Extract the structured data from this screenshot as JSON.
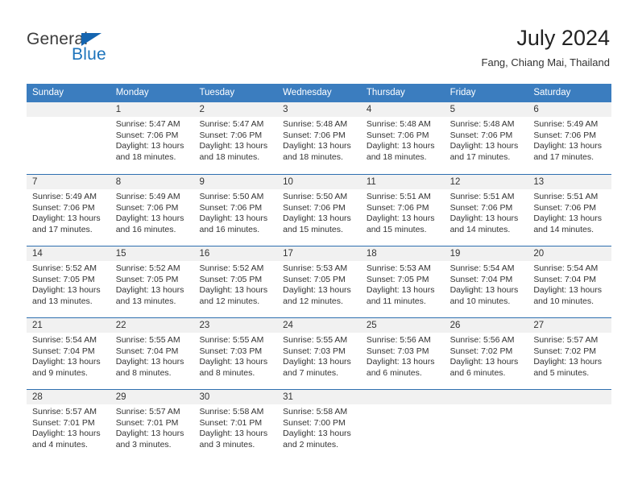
{
  "brand": {
    "name_part1": "General",
    "name_part2": "Blue",
    "accent_color": "#1c73bb"
  },
  "header": {
    "title": "July 2024",
    "subtitle": "Fang, Chiang Mai, Thailand"
  },
  "theme": {
    "header_band": "#3b7dbf",
    "day_band": "#f1f1f1",
    "separator": "#2f6fb0"
  },
  "weekdays": [
    "Sunday",
    "Monday",
    "Tuesday",
    "Wednesday",
    "Thursday",
    "Friday",
    "Saturday"
  ],
  "weeks": [
    [
      {
        "day": "",
        "sunrise": "",
        "sunset": "",
        "daylight": ""
      },
      {
        "day": "1",
        "sunrise": "Sunrise: 5:47 AM",
        "sunset": "Sunset: 7:06 PM",
        "daylight": "Daylight: 13 hours and 18 minutes."
      },
      {
        "day": "2",
        "sunrise": "Sunrise: 5:47 AM",
        "sunset": "Sunset: 7:06 PM",
        "daylight": "Daylight: 13 hours and 18 minutes."
      },
      {
        "day": "3",
        "sunrise": "Sunrise: 5:48 AM",
        "sunset": "Sunset: 7:06 PM",
        "daylight": "Daylight: 13 hours and 18 minutes."
      },
      {
        "day": "4",
        "sunrise": "Sunrise: 5:48 AM",
        "sunset": "Sunset: 7:06 PM",
        "daylight": "Daylight: 13 hours and 18 minutes."
      },
      {
        "day": "5",
        "sunrise": "Sunrise: 5:48 AM",
        "sunset": "Sunset: 7:06 PM",
        "daylight": "Daylight: 13 hours and 17 minutes."
      },
      {
        "day": "6",
        "sunrise": "Sunrise: 5:49 AM",
        "sunset": "Sunset: 7:06 PM",
        "daylight": "Daylight: 13 hours and 17 minutes."
      }
    ],
    [
      {
        "day": "7",
        "sunrise": "Sunrise: 5:49 AM",
        "sunset": "Sunset: 7:06 PM",
        "daylight": "Daylight: 13 hours and 17 minutes."
      },
      {
        "day": "8",
        "sunrise": "Sunrise: 5:49 AM",
        "sunset": "Sunset: 7:06 PM",
        "daylight": "Daylight: 13 hours and 16 minutes."
      },
      {
        "day": "9",
        "sunrise": "Sunrise: 5:50 AM",
        "sunset": "Sunset: 7:06 PM",
        "daylight": "Daylight: 13 hours and 16 minutes."
      },
      {
        "day": "10",
        "sunrise": "Sunrise: 5:50 AM",
        "sunset": "Sunset: 7:06 PM",
        "daylight": "Daylight: 13 hours and 15 minutes."
      },
      {
        "day": "11",
        "sunrise": "Sunrise: 5:51 AM",
        "sunset": "Sunset: 7:06 PM",
        "daylight": "Daylight: 13 hours and 15 minutes."
      },
      {
        "day": "12",
        "sunrise": "Sunrise: 5:51 AM",
        "sunset": "Sunset: 7:06 PM",
        "daylight": "Daylight: 13 hours and 14 minutes."
      },
      {
        "day": "13",
        "sunrise": "Sunrise: 5:51 AM",
        "sunset": "Sunset: 7:06 PM",
        "daylight": "Daylight: 13 hours and 14 minutes."
      }
    ],
    [
      {
        "day": "14",
        "sunrise": "Sunrise: 5:52 AM",
        "sunset": "Sunset: 7:05 PM",
        "daylight": "Daylight: 13 hours and 13 minutes."
      },
      {
        "day": "15",
        "sunrise": "Sunrise: 5:52 AM",
        "sunset": "Sunset: 7:05 PM",
        "daylight": "Daylight: 13 hours and 13 minutes."
      },
      {
        "day": "16",
        "sunrise": "Sunrise: 5:52 AM",
        "sunset": "Sunset: 7:05 PM",
        "daylight": "Daylight: 13 hours and 12 minutes."
      },
      {
        "day": "17",
        "sunrise": "Sunrise: 5:53 AM",
        "sunset": "Sunset: 7:05 PM",
        "daylight": "Daylight: 13 hours and 12 minutes."
      },
      {
        "day": "18",
        "sunrise": "Sunrise: 5:53 AM",
        "sunset": "Sunset: 7:05 PM",
        "daylight": "Daylight: 13 hours and 11 minutes."
      },
      {
        "day": "19",
        "sunrise": "Sunrise: 5:54 AM",
        "sunset": "Sunset: 7:04 PM",
        "daylight": "Daylight: 13 hours and 10 minutes."
      },
      {
        "day": "20",
        "sunrise": "Sunrise: 5:54 AM",
        "sunset": "Sunset: 7:04 PM",
        "daylight": "Daylight: 13 hours and 10 minutes."
      }
    ],
    [
      {
        "day": "21",
        "sunrise": "Sunrise: 5:54 AM",
        "sunset": "Sunset: 7:04 PM",
        "daylight": "Daylight: 13 hours and 9 minutes."
      },
      {
        "day": "22",
        "sunrise": "Sunrise: 5:55 AM",
        "sunset": "Sunset: 7:04 PM",
        "daylight": "Daylight: 13 hours and 8 minutes."
      },
      {
        "day": "23",
        "sunrise": "Sunrise: 5:55 AM",
        "sunset": "Sunset: 7:03 PM",
        "daylight": "Daylight: 13 hours and 8 minutes."
      },
      {
        "day": "24",
        "sunrise": "Sunrise: 5:55 AM",
        "sunset": "Sunset: 7:03 PM",
        "daylight": "Daylight: 13 hours and 7 minutes."
      },
      {
        "day": "25",
        "sunrise": "Sunrise: 5:56 AM",
        "sunset": "Sunset: 7:03 PM",
        "daylight": "Daylight: 13 hours and 6 minutes."
      },
      {
        "day": "26",
        "sunrise": "Sunrise: 5:56 AM",
        "sunset": "Sunset: 7:02 PM",
        "daylight": "Daylight: 13 hours and 6 minutes."
      },
      {
        "day": "27",
        "sunrise": "Sunrise: 5:57 AM",
        "sunset": "Sunset: 7:02 PM",
        "daylight": "Daylight: 13 hours and 5 minutes."
      }
    ],
    [
      {
        "day": "28",
        "sunrise": "Sunrise: 5:57 AM",
        "sunset": "Sunset: 7:01 PM",
        "daylight": "Daylight: 13 hours and 4 minutes."
      },
      {
        "day": "29",
        "sunrise": "Sunrise: 5:57 AM",
        "sunset": "Sunset: 7:01 PM",
        "daylight": "Daylight: 13 hours and 3 minutes."
      },
      {
        "day": "30",
        "sunrise": "Sunrise: 5:58 AM",
        "sunset": "Sunset: 7:01 PM",
        "daylight": "Daylight: 13 hours and 3 minutes."
      },
      {
        "day": "31",
        "sunrise": "Sunrise: 5:58 AM",
        "sunset": "Sunset: 7:00 PM",
        "daylight": "Daylight: 13 hours and 2 minutes."
      },
      {
        "day": "",
        "sunrise": "",
        "sunset": "",
        "daylight": ""
      },
      {
        "day": "",
        "sunrise": "",
        "sunset": "",
        "daylight": ""
      },
      {
        "day": "",
        "sunrise": "",
        "sunset": "",
        "daylight": ""
      }
    ]
  ]
}
